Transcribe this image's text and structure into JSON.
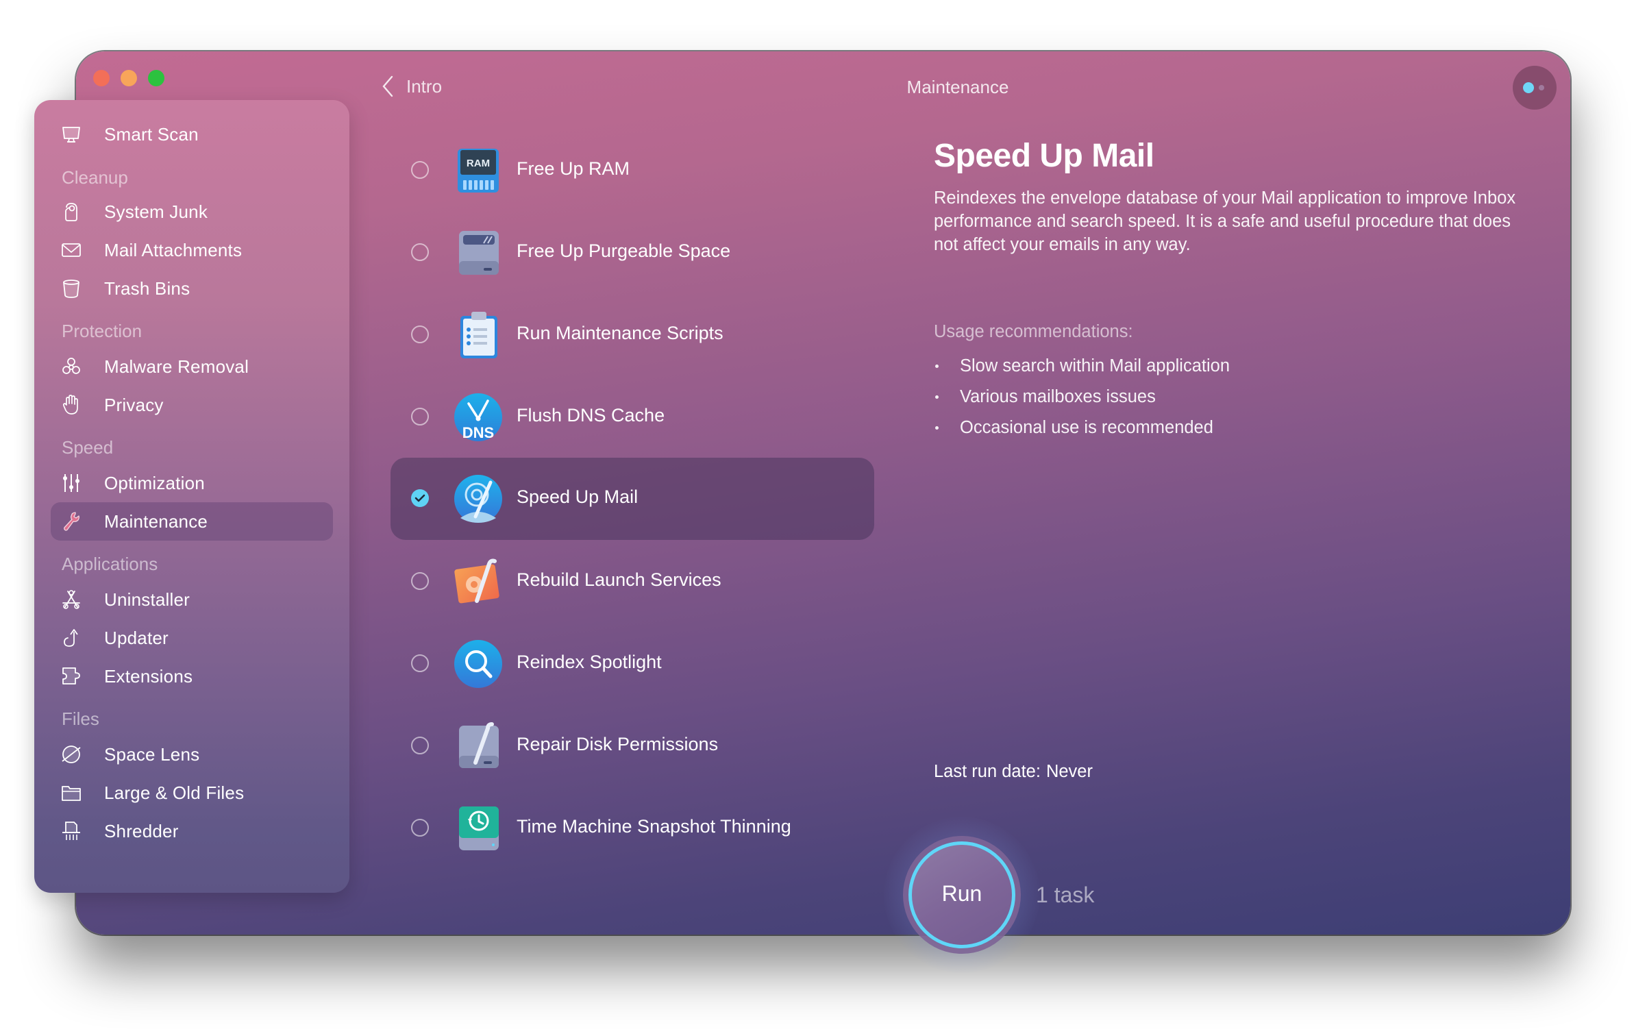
{
  "window": {
    "traffic_lights": [
      "close",
      "minimize",
      "maximize"
    ],
    "colors": {
      "close": "#f36f58",
      "minimize": "#f8a55a",
      "maximize": "#2cc23f"
    }
  },
  "header": {
    "back_label": "Intro",
    "title": "Maintenance",
    "assistant_icon": "assistant-dots-icon"
  },
  "sidebar": {
    "top_item": {
      "label": "Smart Scan",
      "icon": "monitor-icon"
    },
    "sections": [
      {
        "title": "Cleanup",
        "items": [
          {
            "label": "System Junk",
            "icon": "system-junk-icon"
          },
          {
            "label": "Mail Attachments",
            "icon": "envelope-icon"
          },
          {
            "label": "Trash Bins",
            "icon": "trash-bin-icon"
          }
        ]
      },
      {
        "title": "Protection",
        "items": [
          {
            "label": "Malware Removal",
            "icon": "biohazard-icon"
          },
          {
            "label": "Privacy",
            "icon": "hand-icon"
          }
        ]
      },
      {
        "title": "Speed",
        "items": [
          {
            "label": "Optimization",
            "icon": "sliders-icon"
          },
          {
            "label": "Maintenance",
            "icon": "wrench-icon",
            "active": true
          }
        ]
      },
      {
        "title": "Applications",
        "items": [
          {
            "label": "Uninstaller",
            "icon": "app-store-icon"
          },
          {
            "label": "Updater",
            "icon": "update-arrow-icon"
          },
          {
            "label": "Extensions",
            "icon": "puzzle-icon"
          }
        ]
      },
      {
        "title": "Files",
        "items": [
          {
            "label": "Space Lens",
            "icon": "planet-icon"
          },
          {
            "label": "Large & Old Files",
            "icon": "folder-icon"
          },
          {
            "label": "Shredder",
            "icon": "shredder-icon"
          }
        ]
      }
    ],
    "active_icon_color": "#e0708f"
  },
  "tasks": [
    {
      "label": "Free Up RAM",
      "icon": "ram-chip-icon",
      "checked": false,
      "icon_text": "RAM"
    },
    {
      "label": "Free Up Purgeable Space",
      "icon": "hard-drive-icon",
      "checked": false
    },
    {
      "label": "Run Maintenance Scripts",
      "icon": "clipboard-icon",
      "checked": false
    },
    {
      "label": "Flush DNS Cache",
      "icon": "dns-clock-icon",
      "checked": false,
      "icon_text": "DNS"
    },
    {
      "label": "Speed Up Mail",
      "icon": "mail-speedometer-icon",
      "checked": true,
      "selected": true
    },
    {
      "label": "Rebuild Launch Services",
      "icon": "gear-wrench-icon",
      "checked": false
    },
    {
      "label": "Reindex Spotlight",
      "icon": "magnifier-icon",
      "checked": false
    },
    {
      "label": "Repair Disk Permissions",
      "icon": "disk-wrench-icon",
      "checked": false
    },
    {
      "label": "Time Machine Snapshot Thinning",
      "icon": "time-machine-icon",
      "checked": false
    }
  ],
  "detail": {
    "title": "Speed Up Mail",
    "description": "Reindexes the envelope database of your Mail application to improve Inbox performance and search speed. It is a safe and useful procedure that does not affect your emails in any way.",
    "usage_header": "Usage recommendations:",
    "usage_items": [
      "Slow search within Mail application",
      "Various mailboxes issues",
      "Occasional use is recommended"
    ],
    "last_run_label": "Last run date:",
    "last_run_value": "Never"
  },
  "footer": {
    "run_label": "Run",
    "task_count": "1 task",
    "ring_color": "#5fd6f8"
  }
}
